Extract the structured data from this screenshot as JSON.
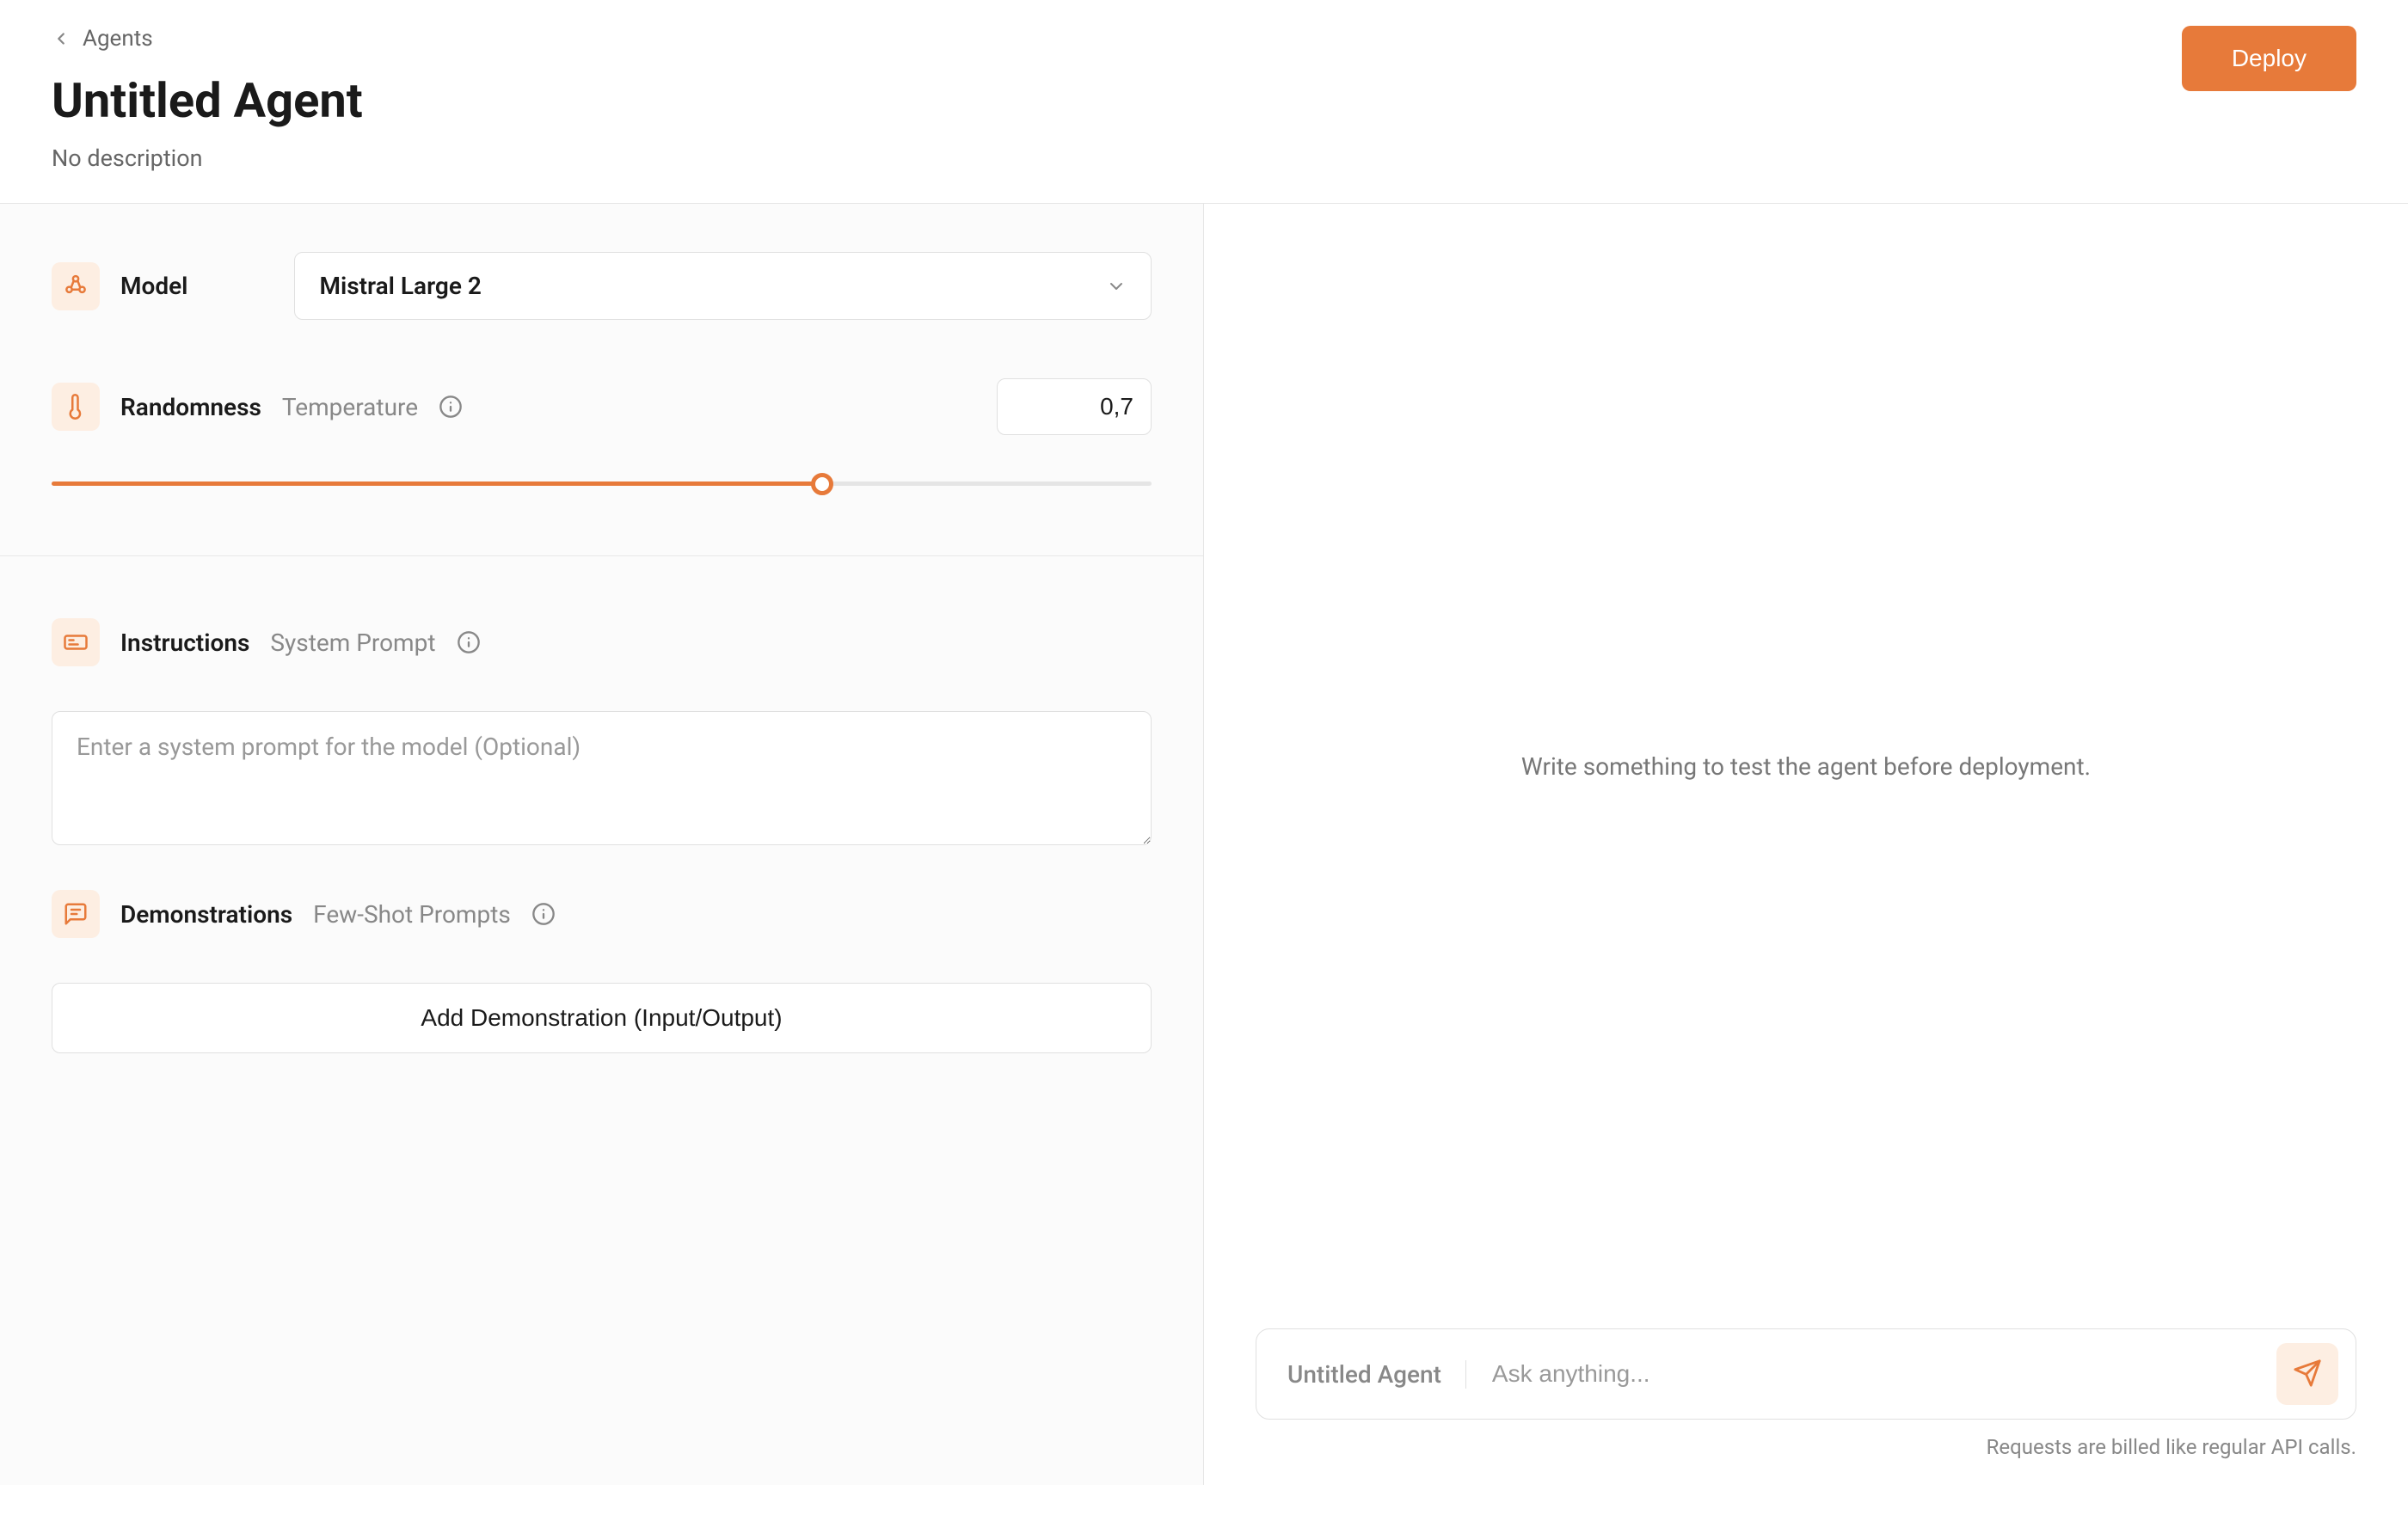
{
  "breadcrumb": {
    "label": "Agents"
  },
  "header": {
    "title": "Untitled Agent",
    "description": "No description",
    "deploy_label": "Deploy"
  },
  "config": {
    "model": {
      "label": "Model",
      "selected": "Mistral Large 2"
    },
    "randomness": {
      "label": "Randomness",
      "sublabel": "Temperature",
      "value": "0,7",
      "slider_percent": 70
    },
    "instructions": {
      "label": "Instructions",
      "sublabel": "System Prompt",
      "placeholder": "Enter a system prompt for the model (Optional)"
    },
    "demonstrations": {
      "label": "Demonstrations",
      "sublabel": "Few-Shot Prompts",
      "add_button": "Add Demonstration (Input/Output)"
    }
  },
  "chat": {
    "empty_message": "Write something to test the agent before deployment.",
    "agent_name": "Untitled Agent",
    "input_placeholder": "Ask anything...",
    "billing_note": "Requests are billed like regular API calls."
  }
}
